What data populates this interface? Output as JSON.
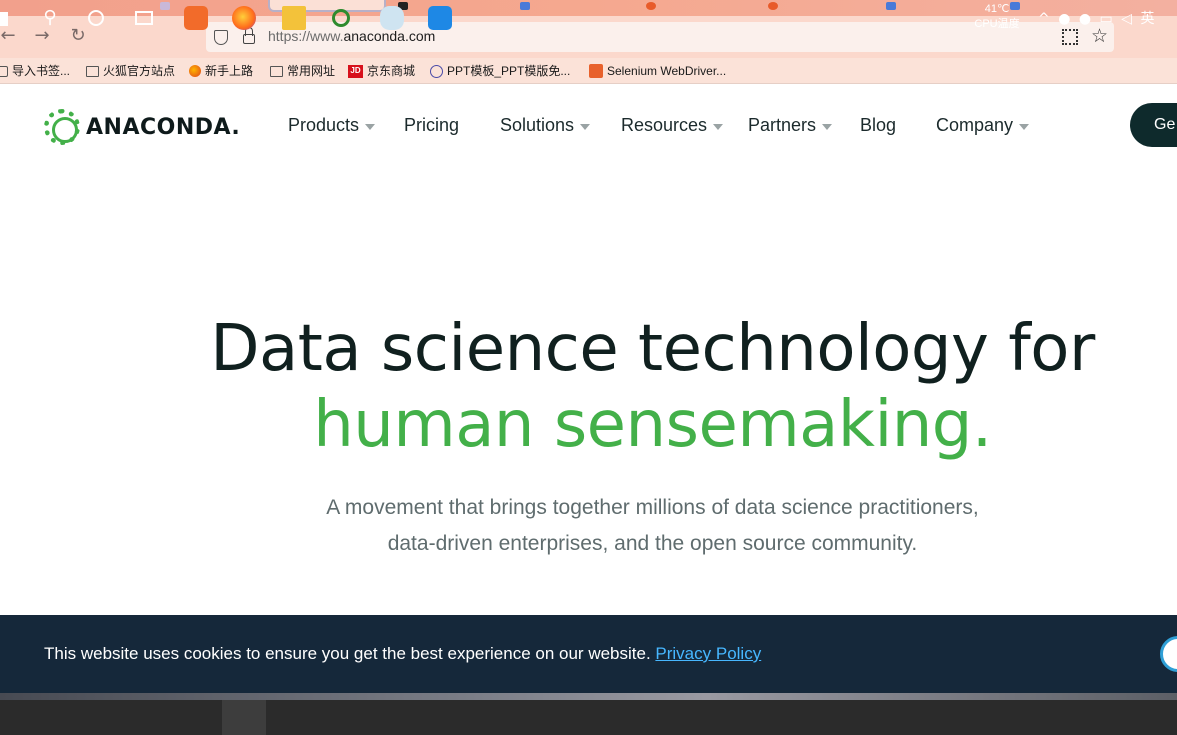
{
  "browser": {
    "url_prefix": "https://www.",
    "url_domain": "anaconda.com",
    "bookmarks": [
      {
        "label": "导入书签...",
        "icon": "import-icon"
      },
      {
        "label": "火狐官方站点",
        "icon": "folder-icon"
      },
      {
        "label": "新手上路",
        "icon": "firefox-icon"
      },
      {
        "label": "常用网址",
        "icon": "folder-icon"
      },
      {
        "label": "京东商城",
        "icon": "jd-icon"
      },
      {
        "label": "PPT模板_PPT模版免...",
        "icon": "globe-icon"
      },
      {
        "label": "Selenium WebDriver...",
        "icon": "jian-icon"
      }
    ]
  },
  "site": {
    "logo_text": "ANACONDA.",
    "nav": [
      {
        "label": "Products",
        "has_dropdown": true
      },
      {
        "label": "Pricing",
        "has_dropdown": false
      },
      {
        "label": "Solutions",
        "has_dropdown": true
      },
      {
        "label": "Resources",
        "has_dropdown": true
      },
      {
        "label": "Partners",
        "has_dropdown": true
      },
      {
        "label": "Blog",
        "has_dropdown": false
      },
      {
        "label": "Company",
        "has_dropdown": true
      }
    ],
    "cta_label": "Ge"
  },
  "hero": {
    "line1": "Data science technology for",
    "line2": "human sensemaking.",
    "sub1": "A movement that brings together millions of data science practitioners,",
    "sub2": "data-driven enterprises, and the open source community."
  },
  "cookie": {
    "text": "This website uses cookies to ensure you get the best experience on our website. ",
    "link": "Privacy Policy"
  },
  "taskbar": {
    "temp": "41℃",
    "temp_label": "CPU温度",
    "tray_lang": "英"
  },
  "colors": {
    "brand_green": "#43b049",
    "cookie_bg": "#15283a",
    "link_blue": "#47b7ff"
  }
}
